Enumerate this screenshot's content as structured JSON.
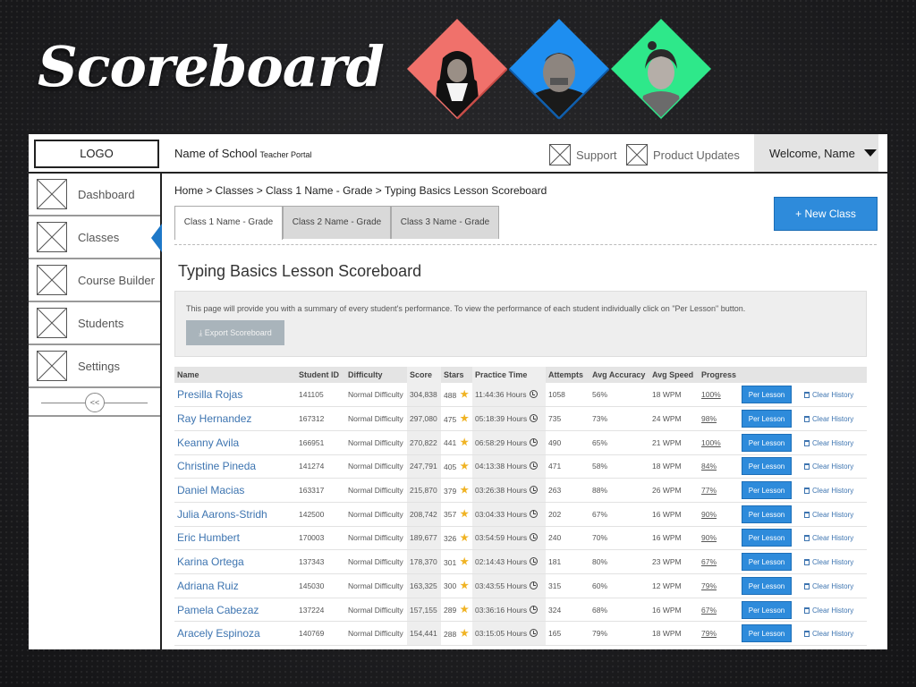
{
  "slide_title": "Scoreboard",
  "header": {
    "logo": "LOGO",
    "school_name": "Name of School",
    "portal_label": "Teacher Portal",
    "support": "Support",
    "product_updates": "Product Updates",
    "welcome": "Welcome, Name"
  },
  "sidebar": {
    "items": [
      {
        "label": "Dashboard"
      },
      {
        "label": "Classes"
      },
      {
        "label": "Course Builder"
      },
      {
        "label": "Students"
      },
      {
        "label": "Settings"
      }
    ],
    "collapse": "<<"
  },
  "breadcrumb": "Home > Classes > Class 1 Name - Grade > Typing Basics Lesson Scoreboard",
  "tabs": [
    "Class 1 Name - Grade",
    "Class 2 Name - Grade",
    "Class 3 Name - Grade"
  ],
  "new_class_button": "+ New Class",
  "page_title": "Typing Basics Lesson Scoreboard",
  "info": {
    "text": "This page will provide you with a summary of every student's performance. To view the performance of each student individually click on \"Per Lesson\" button.",
    "export_button": "Export Scoreboard"
  },
  "table": {
    "headers": [
      "Name",
      "Student ID",
      "Difficulty",
      "Score",
      "Stars",
      "Practice Time",
      "Attempts",
      "Avg Accuracy",
      "Avg Speed",
      "Progress",
      "",
      ""
    ],
    "per_lesson_label": "Per Lesson",
    "clear_history_label": "Clear History",
    "rows": [
      {
        "name": "Presilla Rojas",
        "id": "141105",
        "difficulty": "Normal Difficulty",
        "score": "304,838",
        "stars": "488",
        "time": "11:44:36 Hours",
        "attempts": "1058",
        "accuracy": "56%",
        "speed": "18 WPM",
        "progress": "100%"
      },
      {
        "name": "Ray Hernandez",
        "id": "167312",
        "difficulty": "Normal Difficulty",
        "score": "297,080",
        "stars": "475",
        "time": "05:18:39 Hours",
        "attempts": "735",
        "accuracy": "73%",
        "speed": "24 WPM",
        "progress": "98%"
      },
      {
        "name": "Keanny Avila",
        "id": "166951",
        "difficulty": "Normal Difficulty",
        "score": "270,822",
        "stars": "441",
        "time": "06:58:29 Hours",
        "attempts": "490",
        "accuracy": "65%",
        "speed": "21 WPM",
        "progress": "100%"
      },
      {
        "name": "Christine Pineda",
        "id": "141274",
        "difficulty": "Normal Difficulty",
        "score": "247,791",
        "stars": "405",
        "time": "04:13:38 Hours",
        "attempts": "471",
        "accuracy": "58%",
        "speed": "18 WPM",
        "progress": "84%"
      },
      {
        "name": "Daniel Macias",
        "id": "163317",
        "difficulty": "Normal Difficulty",
        "score": "215,870",
        "stars": "379",
        "time": "03:26:38 Hours",
        "attempts": "263",
        "accuracy": "88%",
        "speed": "26 WPM",
        "progress": "77%"
      },
      {
        "name": "Julia Aarons-Stridh",
        "id": "142500",
        "difficulty": "Normal Difficulty",
        "score": "208,742",
        "stars": "357",
        "time": "03:04:33 Hours",
        "attempts": "202",
        "accuracy": "67%",
        "speed": "16 WPM",
        "progress": "90%"
      },
      {
        "name": "Eric Humbert",
        "id": "170003",
        "difficulty": "Normal Difficulty",
        "score": "189,677",
        "stars": "326",
        "time": "03:54:59 Hours",
        "attempts": "240",
        "accuracy": "70%",
        "speed": "16 WPM",
        "progress": "90%"
      },
      {
        "name": "Karina Ortega",
        "id": "137343",
        "difficulty": "Normal Difficulty",
        "score": "178,370",
        "stars": "301",
        "time": "02:14:43 Hours",
        "attempts": "181",
        "accuracy": "80%",
        "speed": "23 WPM",
        "progress": "67%"
      },
      {
        "name": "Adriana Ruiz",
        "id": "145030",
        "difficulty": "Normal Difficulty",
        "score": "163,325",
        "stars": "300",
        "time": "03:43:55 Hours",
        "attempts": "315",
        "accuracy": "60%",
        "speed": "12 WPM",
        "progress": "79%"
      },
      {
        "name": "Pamela Cabezaz",
        "id": "137224",
        "difficulty": "Normal Difficulty",
        "score": "157,155",
        "stars": "289",
        "time": "03:36:16 Hours",
        "attempts": "324",
        "accuracy": "68%",
        "speed": "16 WPM",
        "progress": "67%"
      },
      {
        "name": "Aracely Espinoza",
        "id": "140769",
        "difficulty": "Normal Difficulty",
        "score": "154,441",
        "stars": "288",
        "time": "03:15:05 Hours",
        "attempts": "165",
        "accuracy": "79%",
        "speed": "18 WPM",
        "progress": "79%"
      }
    ]
  },
  "colors": {
    "accent": "#2e8bdb",
    "link": "#3d74b0",
    "diamond_left": "#f0716b",
    "diamond_middle": "#1e8ef0",
    "diamond_right": "#2ee88a"
  }
}
